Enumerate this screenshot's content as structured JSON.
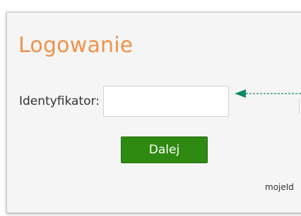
{
  "login": {
    "title": "Logowanie",
    "identifier_label": "Identyfikator:",
    "identifier_value": "",
    "next_label": "Dalej",
    "footer_text": "mojeId"
  },
  "colors": {
    "title": "#f0914a",
    "button": "#2e8a10",
    "arrow": "#13866a"
  },
  "icons": {
    "arrow": "left-arrow-dashed"
  }
}
